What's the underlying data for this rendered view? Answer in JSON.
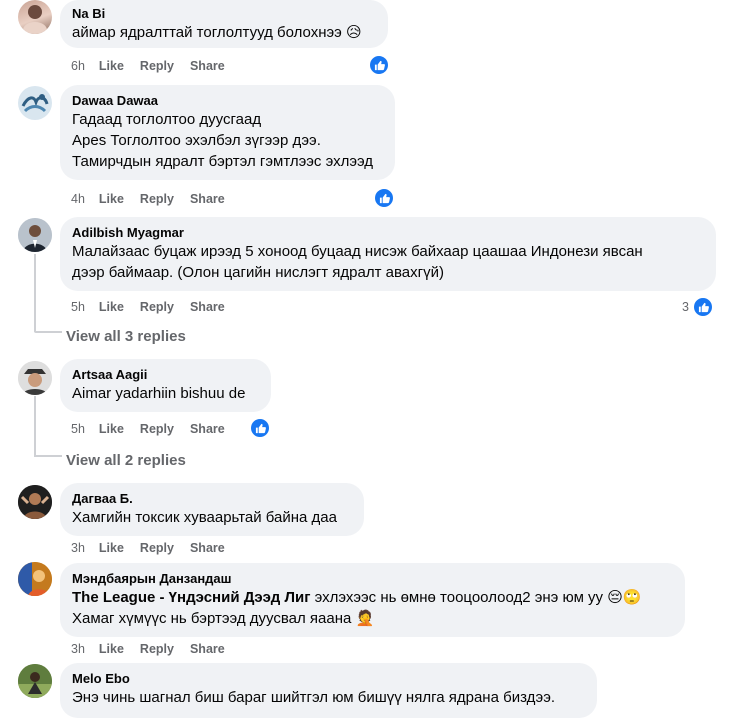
{
  "comments": [
    {
      "author": "Na Bi",
      "lines": [
        "аймар ядралттай тоглолтууд болохнээ 😥"
      ],
      "time": "6h"
    },
    {
      "author": "Dawaa Dawaa",
      "lines": [
        "Гадаад тоглолтоо дуусгаад",
        "Apes Тоглолтоо эхэлбэл зүгээр дээ.",
        "Тамирчдын ядралт бэртэл гэмтлээс эхлээд"
      ],
      "time": "4h"
    },
    {
      "author": "Adilbish Myagmar",
      "lines": [
        "Малайзаас буцаж ирээд 5 хоноод буцаад нисэж байхаар цаашаа Индонези явсан",
        "дээр баймаар. (Олон цагийн нислэгт ядралт авахгүй)"
      ],
      "time": "5h",
      "reaction_count": "3"
    },
    {
      "author": "Artsaa Aagii",
      "lines": [
        "Aimar yadarhiin bishuu de"
      ],
      "time": "5h"
    },
    {
      "author": "Дагваа Б.",
      "lines": [
        "Хамгийн токсик хуваарьтай байна даа"
      ],
      "time": "3h"
    },
    {
      "author": "Мэндбаярын Данзандаш",
      "tag": "The League - Үндэсний Дээд Лиг",
      "line1_rest": " эхлэхээс нь өмнө тооцоолоод2 энэ юм уу 😔🙄",
      "line2": "Хамаг хүмүүс нь бэртээд дуусвал яаана 🤦",
      "time": "3h"
    },
    {
      "author": "Melo Ebo",
      "lines": [
        "Энэ чинь шагнал биш бараг шийтгэл юм бишүү нялга ядрана биздээ."
      ]
    }
  ],
  "actions": {
    "like": "Like",
    "reply": "Reply",
    "share": "Share"
  },
  "view_replies": [
    "View all 3 replies",
    "View all 2 replies"
  ],
  "colors": {
    "bubble": "#f0f2f5",
    "like_blue": "#1877f2",
    "meta_gray": "#65676b"
  }
}
